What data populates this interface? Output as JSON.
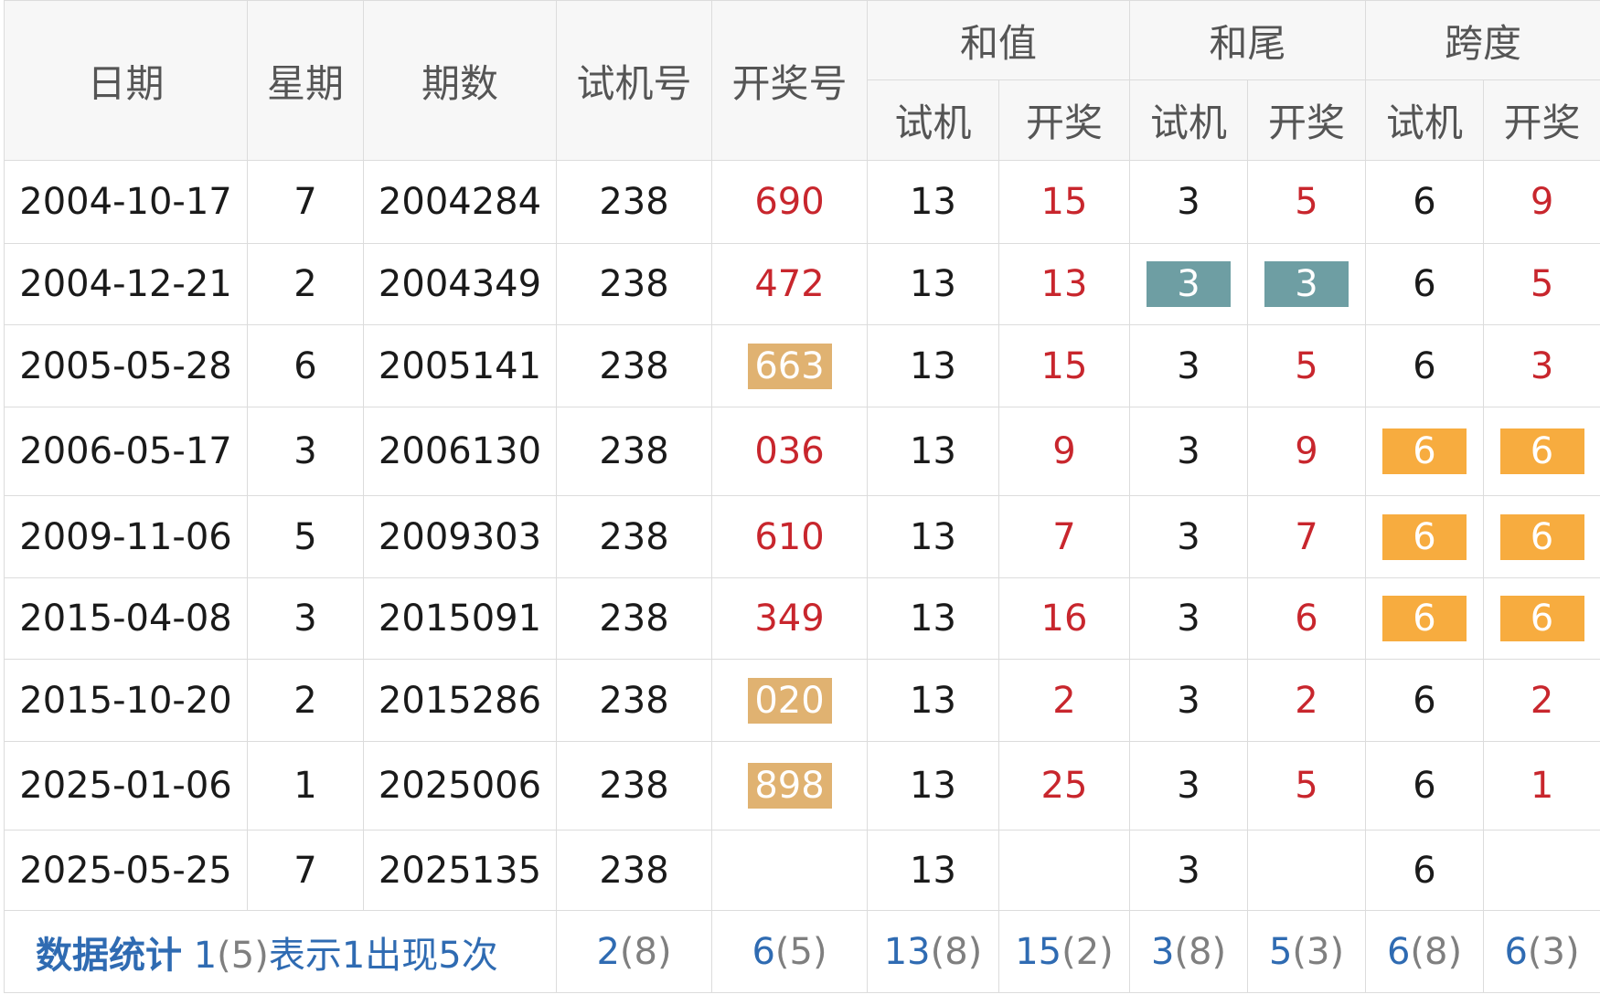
{
  "colors": {
    "draw_red": "#c8262d",
    "tan_highlight": "#e0b271",
    "teal_highlight": "#6e9ea3",
    "orange_highlight": "#f7ac3f",
    "stat_blue": "#2f6bb2"
  },
  "headers": {
    "date": "日期",
    "weekday": "星期",
    "issue": "期数",
    "test_no": "试机号",
    "draw_no": "开奖号",
    "sum_group": "和值",
    "tail_group": "和尾",
    "span_group": "跨度",
    "sub_test": "试机",
    "sub_draw": "开奖"
  },
  "rows": [
    {
      "date": "2004-10-17",
      "weekday": "7",
      "issue": "2004284",
      "test": "238",
      "draw": "690",
      "sum_t": "13",
      "sum_d": "15",
      "tail_t": "3",
      "tail_d": "5",
      "span_t": "6",
      "span_d": "9"
    },
    {
      "date": "2004-12-21",
      "weekday": "2",
      "issue": "2004349",
      "test": "238",
      "draw": "472",
      "sum_t": "13",
      "sum_d": "13",
      "tail_t": "3",
      "tail_d": "3",
      "span_t": "6",
      "span_d": "5"
    },
    {
      "date": "2005-05-28",
      "weekday": "6",
      "issue": "2005141",
      "test": "238",
      "draw": "663",
      "sum_t": "13",
      "sum_d": "15",
      "tail_t": "3",
      "tail_d": "5",
      "span_t": "6",
      "span_d": "3"
    },
    {
      "date": "2006-05-17",
      "weekday": "3",
      "issue": "2006130",
      "test": "238",
      "draw": "036",
      "sum_t": "13",
      "sum_d": "9",
      "tail_t": "3",
      "tail_d": "9",
      "span_t": "6",
      "span_d": "6"
    },
    {
      "date": "2009-11-06",
      "weekday": "5",
      "issue": "2009303",
      "test": "238",
      "draw": "610",
      "sum_t": "13",
      "sum_d": "7",
      "tail_t": "3",
      "tail_d": "7",
      "span_t": "6",
      "span_d": "6"
    },
    {
      "date": "2015-04-08",
      "weekday": "3",
      "issue": "2015091",
      "test": "238",
      "draw": "349",
      "sum_t": "13",
      "sum_d": "16",
      "tail_t": "3",
      "tail_d": "6",
      "span_t": "6",
      "span_d": "6"
    },
    {
      "date": "2015-10-20",
      "weekday": "2",
      "issue": "2015286",
      "test": "238",
      "draw": "020",
      "sum_t": "13",
      "sum_d": "2",
      "tail_t": "3",
      "tail_d": "2",
      "span_t": "6",
      "span_d": "2"
    },
    {
      "date": "2025-01-06",
      "weekday": "1",
      "issue": "2025006",
      "test": "238",
      "draw": "898",
      "sum_t": "13",
      "sum_d": "25",
      "tail_t": "3",
      "tail_d": "5",
      "span_t": "6",
      "span_d": "1"
    },
    {
      "date": "2025-05-25",
      "weekday": "7",
      "issue": "2025135",
      "test": "238",
      "draw": "",
      "sum_t": "13",
      "sum_d": "",
      "tail_t": "3",
      "tail_d": "",
      "span_t": "6",
      "span_d": ""
    }
  ],
  "summary": {
    "label": "数据统计",
    "note_num": "1",
    "note_cnt": "(5)",
    "note_text": "表示1出现5次",
    "test": {
      "v": "2",
      "c": "(8)"
    },
    "draw": {
      "v": "6",
      "c": "(5)"
    },
    "sum_t": {
      "v": "13",
      "c": "(8)"
    },
    "sum_d": {
      "v": "15",
      "c": "(2)"
    },
    "tail_t": {
      "v": "3",
      "c": "(8)"
    },
    "tail_d": {
      "v": "5",
      "c": "(3)"
    },
    "span_t": {
      "v": "6",
      "c": "(8)"
    },
    "span_d": {
      "v": "6",
      "c": "(3)"
    }
  }
}
